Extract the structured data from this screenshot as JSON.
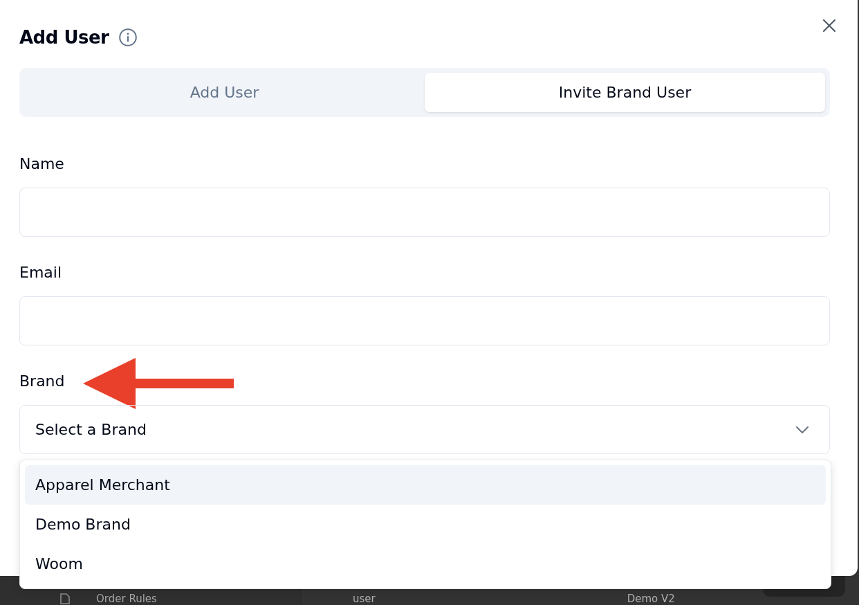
{
  "dialog": {
    "title": "Add User",
    "tabs": [
      {
        "label": "Add User",
        "selected": false
      },
      {
        "label": "Invite Brand User",
        "selected": true
      }
    ],
    "fields": [
      {
        "kind": "text",
        "label": "Name"
      },
      {
        "kind": "text",
        "label": "Email"
      },
      {
        "kind": "select",
        "label": "Brand",
        "placeholder": "Select a Brand",
        "expanded": true,
        "annotation": {
          "kind": "arrow"
        },
        "options": [
          {
            "label": "Apparel Merchant",
            "highlighted": true
          },
          {
            "label": "Demo Brand",
            "highlighted": false
          },
          {
            "label": "Woom",
            "highlighted": false
          }
        ]
      }
    ]
  },
  "background_page": {
    "sidebar_items": [
      {
        "label": "Order Rules"
      }
    ],
    "table_row": {
      "cells": [
        "user",
        "Demo V2"
      ]
    }
  }
}
